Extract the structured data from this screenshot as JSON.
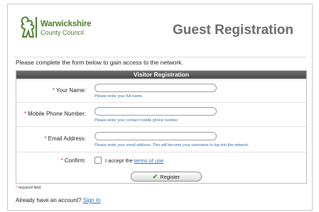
{
  "logo": {
    "line1": "Warwickshire",
    "line2": "County Council"
  },
  "title": "Guest Registration",
  "intro": "Please complete the form below to gain access to the network.",
  "panel_title": "Visitor Registration",
  "fields": [
    {
      "label": "Your Name:",
      "hint": "Please enter your full name."
    },
    {
      "label": "Mobile Phone Number:",
      "hint": "Please enter your contact mobile phone number."
    },
    {
      "label": "Email Address:",
      "hint": "Please enter your email address. This will become your username to log into the network."
    }
  ],
  "confirm": {
    "label": "Confirm:",
    "text": "I accept the ",
    "link": "terms of use"
  },
  "register_label": "Register",
  "required_note": "required field",
  "already": {
    "text": "Already have an account? ",
    "link": "Sign In"
  },
  "colors": {
    "accent_link": "#2b6fb5",
    "required_star": "#d9241e",
    "brand_green": "#4a7d2a",
    "panel_header": "#555555"
  },
  "icons": {
    "logo": "bear-and-ragged-staff-logo",
    "register": "check-icon"
  }
}
